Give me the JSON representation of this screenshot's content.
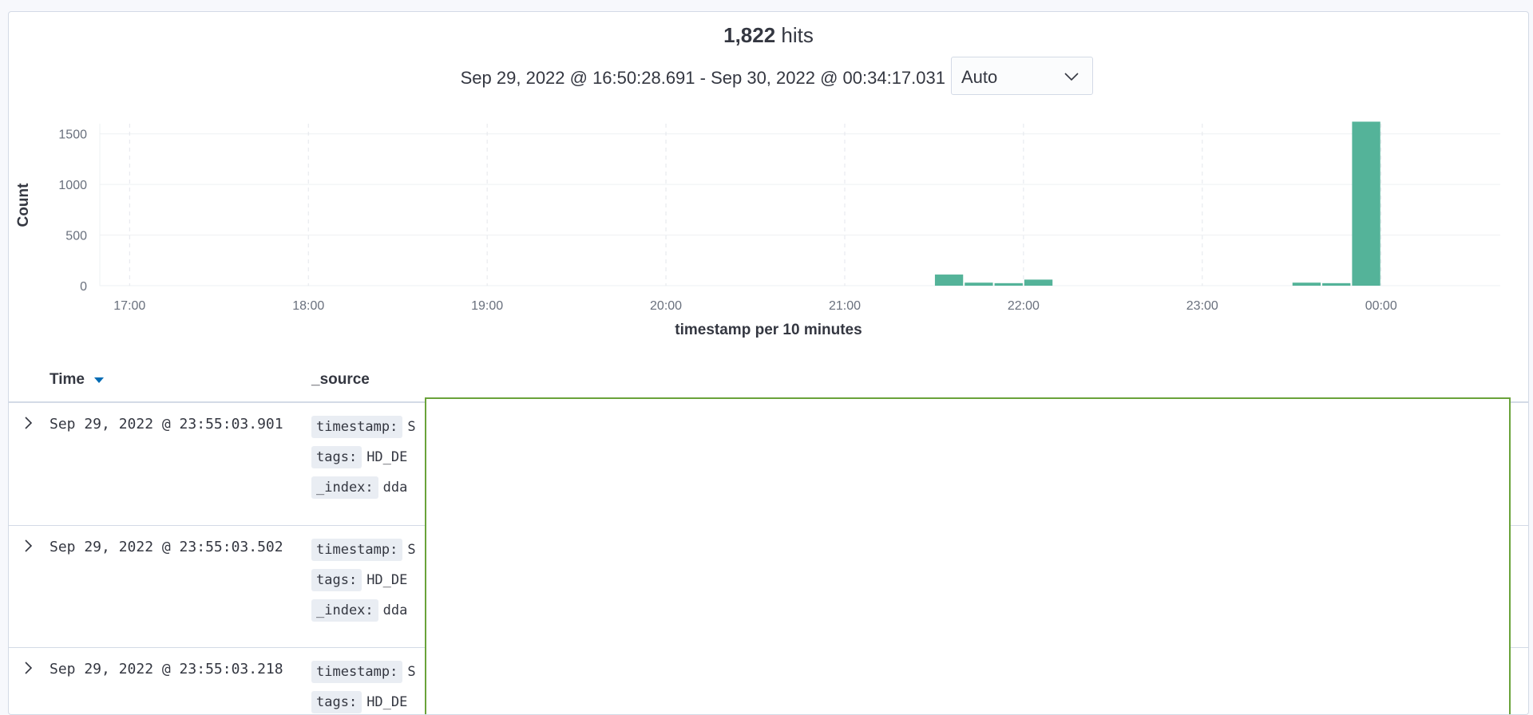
{
  "header": {
    "hits_count": "1,822",
    "hits_label": "hits",
    "time_range": "Sep 29, 2022 @ 16:50:28.691 - Sep 30, 2022 @ 00:34:17.031",
    "interval_value": "Auto"
  },
  "chart_data": {
    "type": "bar",
    "ylabel": "Count",
    "xlabel": "timestamp per 10 minutes",
    "ylim": [
      0,
      1600
    ],
    "y_ticks": [
      "0",
      "500",
      "1000",
      "1500"
    ],
    "x_ticks": [
      "17:00",
      "18:00",
      "19:00",
      "20:00",
      "21:00",
      "22:00",
      "23:00",
      "00:00"
    ],
    "x_range": [
      "16:50",
      "00:40"
    ],
    "bar_interval_minutes": 10,
    "bars": [
      {
        "start": "21:30",
        "value": 110
      },
      {
        "start": "21:40",
        "value": 30
      },
      {
        "start": "21:50",
        "value": 25
      },
      {
        "start": "22:00",
        "value": 60
      },
      {
        "start": "23:30",
        "value": 30
      },
      {
        "start": "23:40",
        "value": 25
      },
      {
        "start": "23:50",
        "value": 1620
      }
    ],
    "color": "#54b399",
    "grid": true
  },
  "table": {
    "col_time": "Time",
    "col_source": "_source",
    "rows": [
      {
        "time": "Sep 29, 2022 @ 23:55:03.901",
        "fields": [
          {
            "key": "timestamp:",
            "value": "S"
          },
          {
            "key": "tags:",
            "value": "HD_DE"
          },
          {
            "key": "_index:",
            "value": "dda"
          }
        ]
      },
      {
        "time": "Sep 29, 2022 @ 23:55:03.502",
        "fields": [
          {
            "key": "timestamp:",
            "value": "S"
          },
          {
            "key": "tags:",
            "value": "HD_DE"
          },
          {
            "key": "_index:",
            "value": "dda"
          }
        ]
      },
      {
        "time": "Sep 29, 2022 @ 23:55:03.218",
        "fields": [
          {
            "key": "timestamp:",
            "value": "S"
          },
          {
            "key": "tags:",
            "value": "HD_DE"
          }
        ]
      }
    ]
  }
}
